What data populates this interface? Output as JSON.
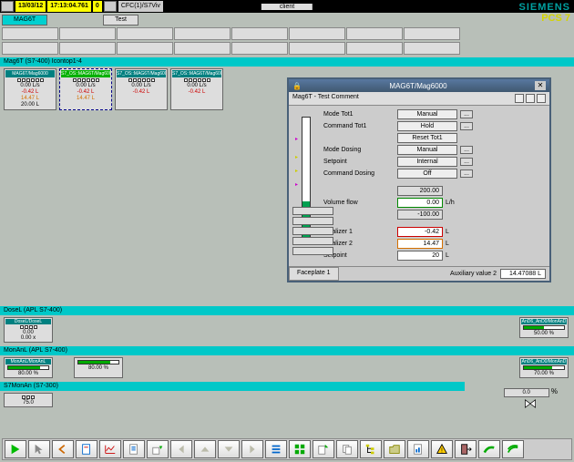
{
  "topbar": {
    "date": "13/03/12",
    "time": "17:13:04.761",
    "num": "0",
    "path": "CFC(1)/S7Viv",
    "client": "client"
  },
  "brand": {
    "name": "SIEMENS",
    "product": "PCS 7"
  },
  "tabs": {
    "t1": "MAG6T",
    "t2": "Test"
  },
  "section1": "Mag6T (S7-400) Icontop1-4",
  "panels": [
    {
      "title": "MAG6T/Mag6000",
      "v1": "0.00 L/s",
      "v2": "-0.42 L",
      "v3": "14.47 L",
      "v4": "20.00 L"
    },
    {
      "title": "S7_OS::MAG6T/Mag6000",
      "v1": "0.00 L/s",
      "v2": "-0.42 L",
      "v3": "14.47 L",
      "v4": ""
    },
    {
      "title": "S7_OS::MAG6T/Mag6000",
      "v1": "0.00 L/s",
      "v2": "-0.42 L",
      "v3": "",
      "v4": ""
    },
    {
      "title": "S7_OS::MAG6T/Mag6000",
      "v1": "0.00 L/s",
      "v2": "-0.42 L",
      "v3": "",
      "v4": ""
    }
  ],
  "faceplate": {
    "title": "MAG6T/Mag6000",
    "subtitle": "Mag6T - Test Comment",
    "rows": {
      "mode_tot1": {
        "label": "Mode Tot1",
        "value": "Manual"
      },
      "cmd_tot1": {
        "label": "Command Tot1",
        "value": "Hold"
      },
      "reset_tot1": "Reset Tot1",
      "mode_dosing": {
        "label": "Mode Dosing",
        "value": "Manual"
      },
      "setpoint_mode": {
        "label": "Setpoint",
        "value": "Internal"
      },
      "cmd_dosing": {
        "label": "Command Dosing",
        "value": "Off"
      },
      "range_hi": "200.00",
      "volume_flow": {
        "label": "Volume flow",
        "value": "0.00",
        "unit": "L/h"
      },
      "range_lo": "-100.00",
      "tot1": {
        "label": "Totalizer 1",
        "value": "-0.42",
        "unit": "L"
      },
      "tot2": {
        "label": "Totalizer 2",
        "value": "14.47",
        "unit": "L"
      },
      "setpoint": {
        "label": "Setpoint",
        "value": "20",
        "unit": "L"
      }
    },
    "tab1": "Faceplate 1",
    "aux_label": "Auxiliary value 2",
    "aux_value": "14.47088",
    "aux_unit": "L"
  },
  "section2": "DoseL (APL S7-400)",
  "dose_panel": {
    "title": "DoseL/DoseL",
    "v1": "0.00",
    "v2": "0.00 x"
  },
  "dose_right": {
    "title": "AnD6_AnD0/MonAnD",
    "val": "50.00 %"
  },
  "section3": "MonAnL (APL S7-400)",
  "mon_left": {
    "title": "MonAnL/MonAnL",
    "val": "80.00 %"
  },
  "mon_mid": {
    "val": "80.00 %"
  },
  "mon_right": {
    "title": "AnD6_AnD0/MonAnD",
    "val": "70.00 %"
  },
  "section4": "S7MonAn (S7-300)",
  "s7_val1": "0.0",
  "s7_val2": "%",
  "s7_panel": {
    "val": "75.0"
  },
  "toolbar_icons": [
    "play",
    "cursor",
    "back",
    "doc1",
    "chart",
    "doc2",
    "import",
    "left",
    "up",
    "down",
    "right",
    "list",
    "grid",
    "export",
    "copy",
    "tree",
    "folder",
    "report",
    "warn",
    "exit",
    "green1",
    "green2"
  ]
}
